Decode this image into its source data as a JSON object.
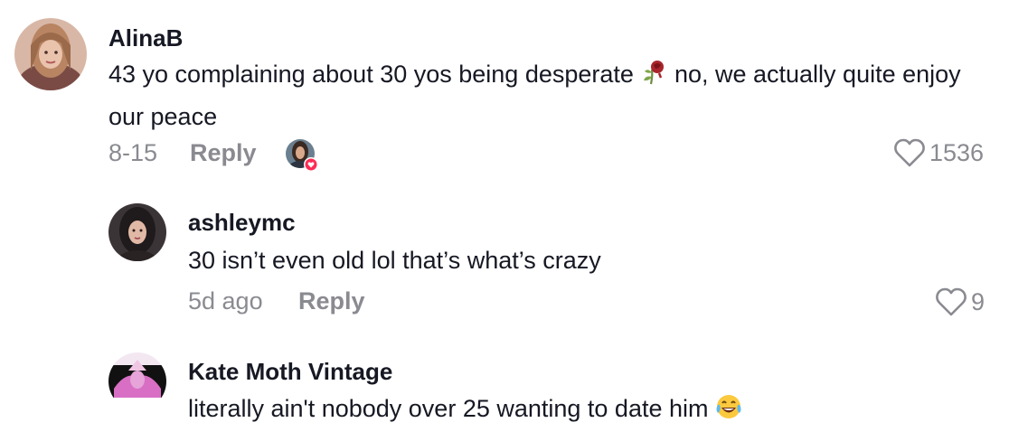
{
  "comments": [
    {
      "username": "AlinaB",
      "text_before_emoji": "43 yo complaining about 30 yos being desperate",
      "emoji": "wilted-rose",
      "text_after_emoji": "no, we actually quite enjoy our peace",
      "date": "8-15",
      "reply_label": "Reply",
      "likes": "1536",
      "creator_liked": true
    },
    {
      "username": "ashleymc",
      "text": "30 isn’t even old lol that’s what’s crazy",
      "date": "5d ago",
      "reply_label": "Reply",
      "likes": "9"
    },
    {
      "username": "Kate Moth Vintage",
      "text": "literally ain't nobody over 25 wanting to date him",
      "emoji": "tears-of-joy"
    }
  ],
  "colors": {
    "primary_text": "#161823",
    "secondary_text": "#8a8b91",
    "like_badge": "#fe2c55"
  }
}
